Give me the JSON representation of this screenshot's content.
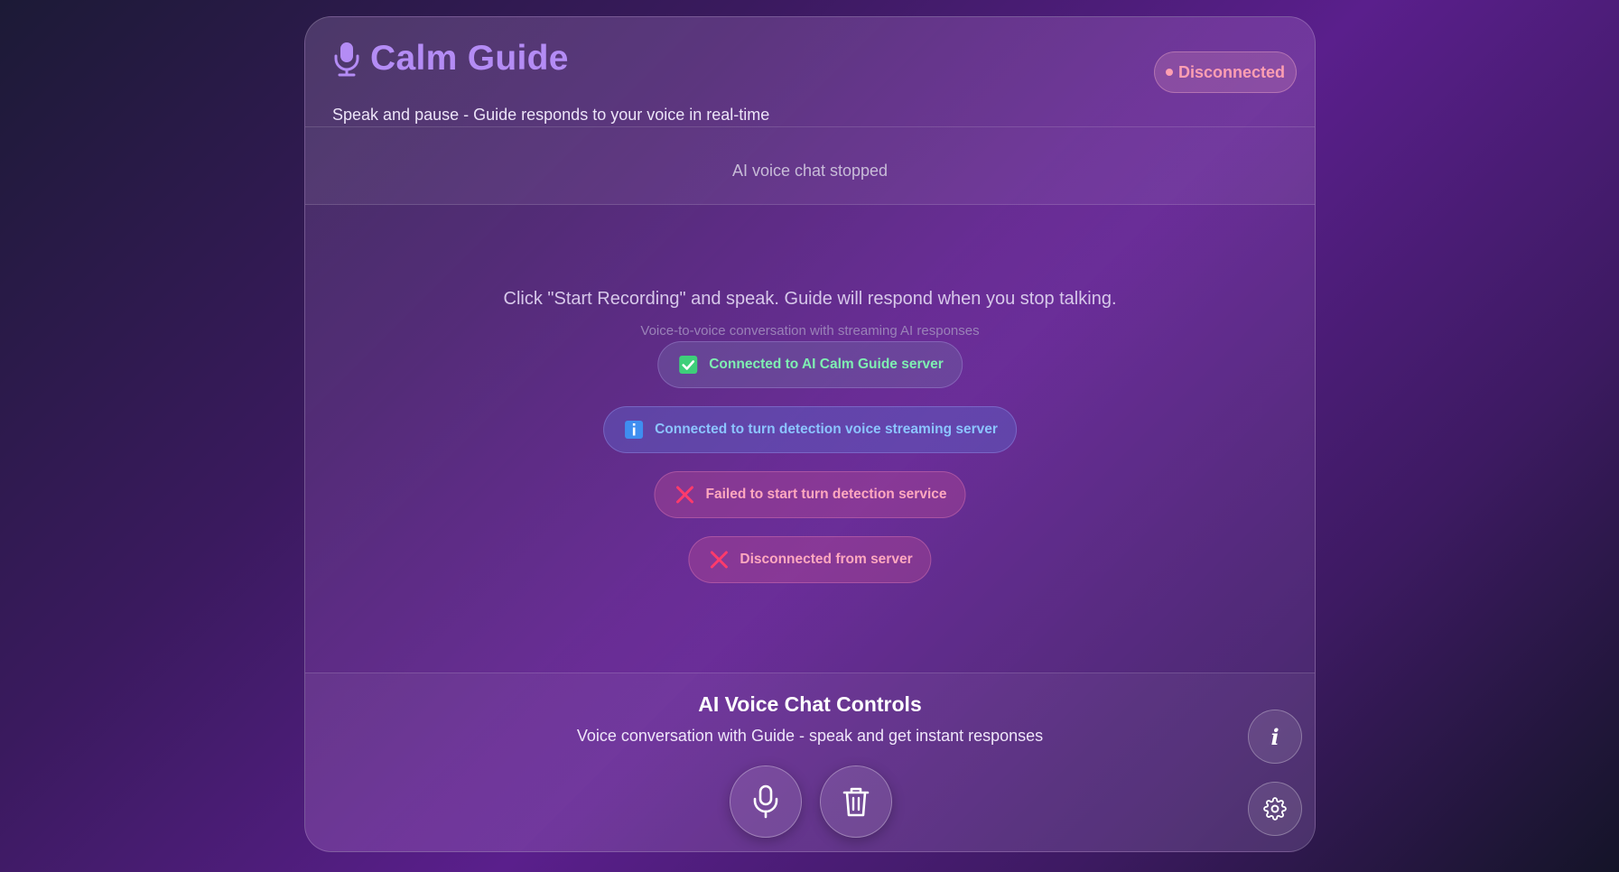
{
  "header": {
    "title": "Calm Guide",
    "subtitle": "Speak and pause - Guide responds to your voice in real-time",
    "connection_status": "Disconnected",
    "logo_icon": "microphone-icon"
  },
  "status_bar": {
    "text": "AI voice chat stopped"
  },
  "main": {
    "instruction": "Click \"Start Recording\" and speak. Guide will respond when you stop talking.",
    "instruction_sub": "Voice-to-voice conversation with streaming AI responses",
    "messages": [
      {
        "type": "success",
        "icon": "check-square-icon",
        "text": "Connected to AI Calm Guide server"
      },
      {
        "type": "info",
        "icon": "info-square-icon",
        "text": "Connected to turn detection voice streaming server"
      },
      {
        "type": "error",
        "icon": "x-icon",
        "text": "Failed to start turn detection service"
      },
      {
        "type": "error",
        "icon": "x-icon",
        "text": "Disconnected from server"
      }
    ]
  },
  "controls": {
    "title": "AI Voice Chat Controls",
    "subtitle": "Voice conversation with Guide - speak and get instant responses",
    "buttons": [
      {
        "icon": "microphone-icon",
        "action": "start-recording"
      },
      {
        "icon": "trash-icon",
        "action": "clear"
      }
    ],
    "side_buttons": [
      {
        "icon": "info-icon",
        "label": "i"
      },
      {
        "icon": "gear-icon"
      }
    ]
  },
  "colors": {
    "title": "#b48cf5",
    "disconnected": "#ff9fb2",
    "success": "#7ff0b2",
    "info": "#8cc4ff",
    "error": "#ffa8bf"
  }
}
